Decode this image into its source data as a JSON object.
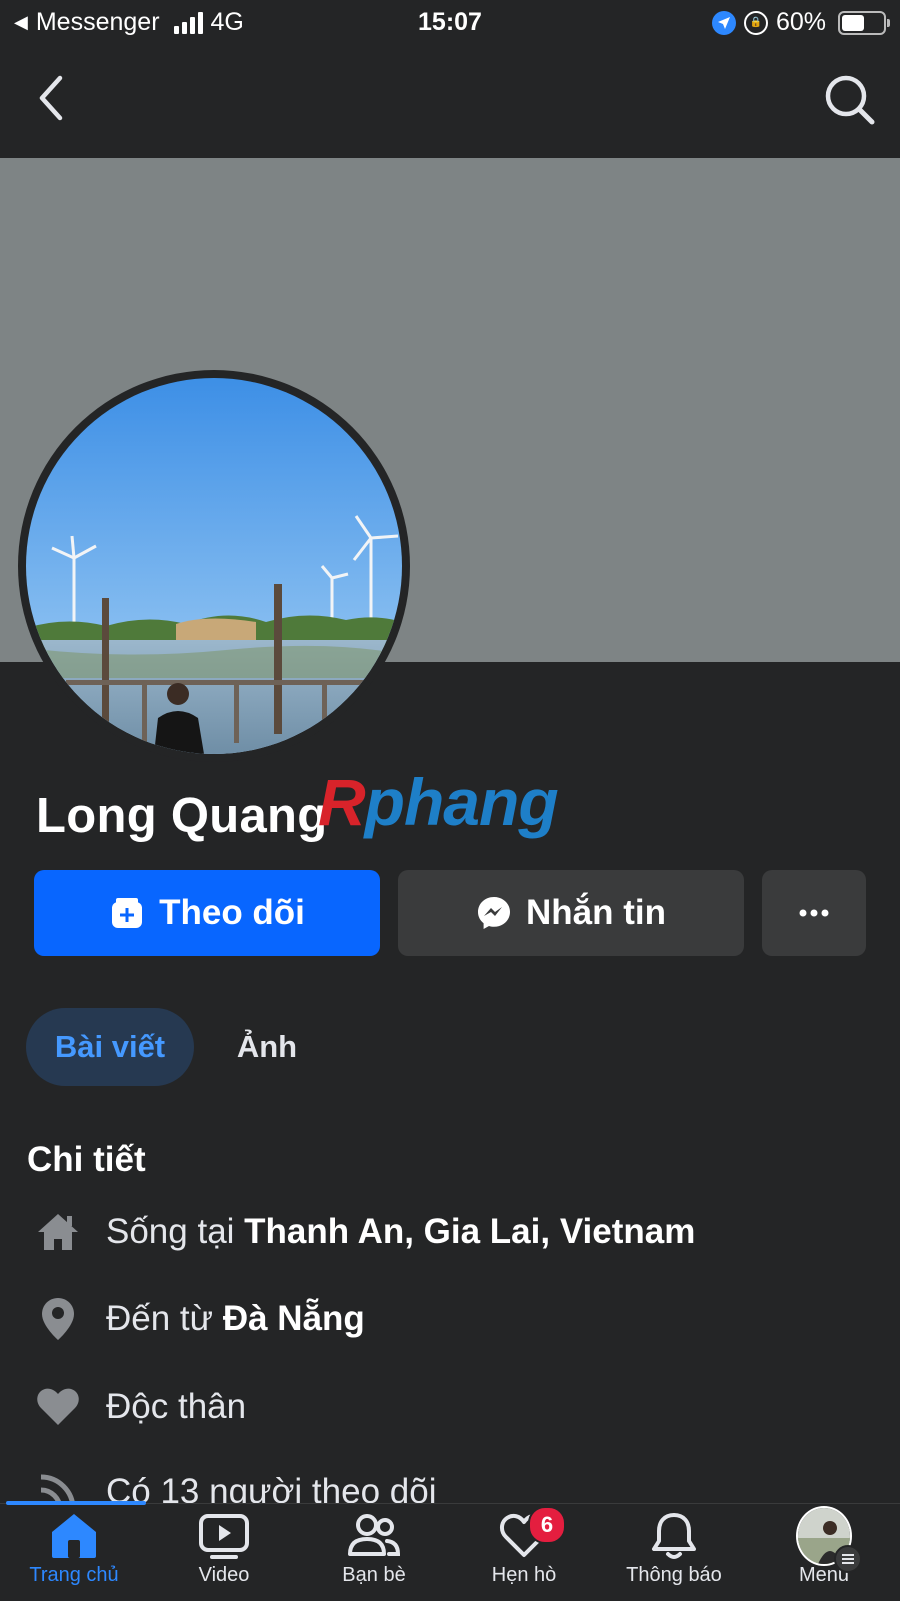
{
  "status_bar": {
    "back_app": "Messenger",
    "network": "4G",
    "time": "15:07",
    "battery": "60%",
    "battery_level": 0.6
  },
  "profile": {
    "name": "Long Quang",
    "watermark_r": "R",
    "watermark_rest": "phang"
  },
  "actions": {
    "follow": "Theo dõi",
    "message": "Nhắn tin",
    "more": "..."
  },
  "tabs": [
    {
      "label": "Bài viết",
      "active": true
    },
    {
      "label": "Ảnh",
      "active": false
    }
  ],
  "details": {
    "title": "Chi tiết",
    "lives_prefix": "Sống tại ",
    "lives_place": "Thanh An, Gia Lai, Vietnam",
    "from_prefix": "Đến từ ",
    "from_place": "Đà Nẵng",
    "relationship": "Độc thân",
    "followers": "Có 13 người theo dõi"
  },
  "bottom_nav": {
    "items": [
      {
        "label": "Trang chủ",
        "icon": "home-icon",
        "active": true
      },
      {
        "label": "Video",
        "icon": "video-icon"
      },
      {
        "label": "Bạn bè",
        "icon": "friends-icon"
      },
      {
        "label": "Hẹn hò",
        "icon": "dating-icon",
        "badge": "6"
      },
      {
        "label": "Thông báo",
        "icon": "bell-icon"
      },
      {
        "label": "Menu",
        "icon": "menu-avatar"
      }
    ]
  },
  "colors": {
    "background": "#242526",
    "primary": "#0866ff",
    "secondary_button": "#3a3b3c",
    "active_blue": "#2d88ff",
    "badge_red": "#e41e3f",
    "cover": "#7e8485"
  }
}
